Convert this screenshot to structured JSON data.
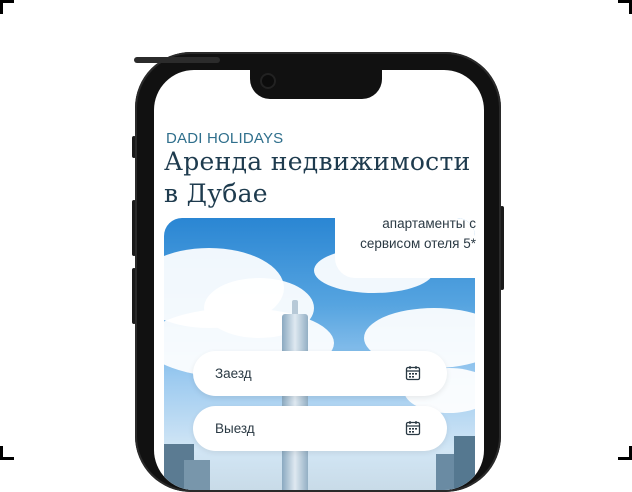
{
  "app": {
    "brand": "DADI HOLIDAYS",
    "headline_line1": "Аренда недвижимости",
    "headline_line2": "в Дубае",
    "tagline_line1": "апартаменты с",
    "tagline_line2": "сервисом отеля 5*"
  },
  "booking_form": {
    "check_in_label": "Заезд",
    "check_out_label": "Выезд"
  },
  "icons": {
    "check_in": "calendar-icon",
    "check_out": "calendar-icon"
  },
  "colors": {
    "brand": "#2f6f8c",
    "headline": "#1e3b4e",
    "sky": "#56a4e0"
  }
}
